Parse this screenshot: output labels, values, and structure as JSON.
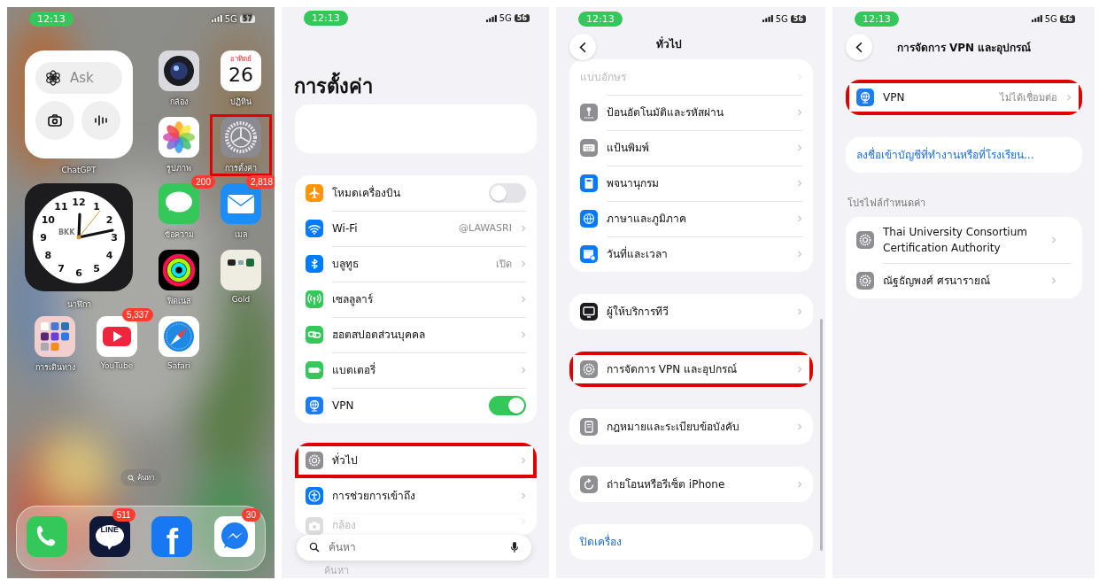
{
  "home": {
    "status": {
      "time": "12:13",
      "network": "5G",
      "battery": "57"
    },
    "items": [
      {
        "kind": "chatgpt",
        "label": "ChatGPT",
        "prompt": "Ask"
      },
      {
        "kind": "camera",
        "label": "กล้อง",
        "highlighted": false
      },
      {
        "kind": "calendar",
        "label": "ปฏิทิน",
        "weekday": "อาทิตย์",
        "day": "26",
        "highlighted": false
      },
      {
        "kind": "photos",
        "label": "รูปภาพ",
        "highlighted": false
      },
      {
        "kind": "settings",
        "label": "การตั้งค่า",
        "highlighted": true
      },
      {
        "kind": "clock",
        "label": "นาฬิกา",
        "city": "BKK",
        "numerals": [
          "11",
          "12",
          "1",
          "10",
          "2",
          "9",
          "3",
          "8",
          "4",
          "7",
          "6",
          "5"
        ]
      },
      {
        "kind": "messages",
        "label": "ข้อความ",
        "badge": "200",
        "highlighted": false
      },
      {
        "kind": "mail",
        "label": "เมล",
        "badge": "2,818",
        "highlighted": false
      },
      {
        "kind": "fitness",
        "label": "ฟิตเนส",
        "highlighted": false
      },
      {
        "kind": "gold",
        "label": "Gold",
        "highlighted": false
      },
      {
        "kind": "folder",
        "label": "การเดินทาง",
        "highlighted": false
      },
      {
        "kind": "youtube",
        "label": "YouTube",
        "badge": "5,337",
        "highlighted": false
      },
      {
        "kind": "safari",
        "label": "Safari",
        "highlighted": false
      }
    ],
    "search": "ค้นหา",
    "dock": [
      {
        "kind": "phone"
      },
      {
        "kind": "line",
        "text": "LINE",
        "badge": "511"
      },
      {
        "kind": "facebook",
        "text": "f"
      },
      {
        "kind": "messenger",
        "badge": "30"
      }
    ]
  },
  "settings": {
    "kind": "root",
    "status": {
      "time": "12:13",
      "network": "5G",
      "battery": "56"
    },
    "title": "การตั้งค่า",
    "groups": [
      {
        "rows": [
          {
            "kind": "toggle",
            "label": "โหมดเครื่องบิน",
            "on": false,
            "highlighted": false
          },
          {
            "kind": "link",
            "label": "Wi-Fi",
            "value": "@LAWASRI",
            "highlighted": false
          },
          {
            "kind": "link",
            "label": "บลูทูธ",
            "value": "เปิด",
            "highlighted": false
          },
          {
            "kind": "link",
            "label": "เซลลูลาร์",
            "highlighted": false
          },
          {
            "kind": "link",
            "label": "ฮอตสปอตส่วนบุคคล",
            "highlighted": false
          },
          {
            "kind": "link",
            "label": "แบตเตอรี่",
            "highlighted": false
          },
          {
            "kind": "toggle",
            "label": "VPN",
            "on": true,
            "highlighted": false
          }
        ]
      },
      {
        "rows": [
          {
            "kind": "link",
            "label": "ทั่วไป",
            "highlighted": true
          },
          {
            "kind": "link",
            "label": "การช่วยการเข้าถึง",
            "highlighted": false
          },
          {
            "kind": "faded",
            "label": "กล้อง",
            "highlighted": false
          }
        ]
      }
    ],
    "search": {
      "placeholder": "ค้นหา"
    },
    "under_search": "ค้นหา"
  },
  "general": {
    "kind": "sub-overlay",
    "status": {
      "time": "12:13",
      "network": "5G",
      "battery": "56"
    },
    "title": "ทั่วไป",
    "groups": [
      {
        "rows": [
          {
            "kind": "faded",
            "label": "แบบอักษร",
            "highlighted": false
          },
          {
            "kind": "link",
            "label": "ป้อนอัตโนมัติและรหัสผ่าน",
            "highlighted": false
          },
          {
            "kind": "link",
            "label": "แป้นพิมพ์",
            "highlighted": false
          },
          {
            "kind": "link",
            "label": "พจนานุกรม",
            "highlighted": false
          },
          {
            "kind": "link",
            "label": "ภาษาและภูมิภาค",
            "highlighted": false
          },
          {
            "kind": "link",
            "label": "วันที่และเวลา",
            "highlighted": false
          }
        ]
      },
      {
        "rows": [
          {
            "kind": "link",
            "label": "ผู้ให้บริการทีวี",
            "highlighted": false
          }
        ]
      },
      {
        "rows": [
          {
            "kind": "link",
            "label": "การจัดการ VPN และอุปกรณ์",
            "highlighted": true
          }
        ]
      },
      {
        "rows": [
          {
            "kind": "link",
            "label": "กฎหมายและระเบียบข้อบังคับ",
            "highlighted": false
          }
        ]
      },
      {
        "rows": [
          {
            "kind": "link",
            "label": "ถ่ายโอนหรือรีเซ็ต iPhone",
            "highlighted": false
          }
        ]
      },
      {
        "rows": [
          {
            "kind": "action",
            "label": "ปิดเครื่อง",
            "highlighted": false
          }
        ]
      }
    ]
  },
  "vpn_device": {
    "kind": "sub",
    "status": {
      "time": "12:13",
      "network": "5G",
      "battery": "56"
    },
    "title": "การจัดการ VPN และอุปกรณ์",
    "groups": [
      {
        "rows": [
          {
            "kind": "link",
            "label": "VPN",
            "value": "ไม่ได้เชื่อมต่อ",
            "highlighted": true
          }
        ]
      },
      {
        "rows": [
          {
            "kind": "action",
            "label": "ลงชื่อเข้าบัญชีที่ทำงานหรือที่โรงเรียน...",
            "highlighted": false
          }
        ]
      },
      {
        "header": "โปรไฟล์กำหนดค่า",
        "rows": [
          {
            "kind": "link",
            "label": "Thai University Consortium Certification Authority",
            "highlighted": false
          },
          {
            "kind": "link",
            "label": "ณัฐธัญพงศ์ ศรนารายณ์",
            "highlighted": false
          }
        ]
      }
    ]
  }
}
